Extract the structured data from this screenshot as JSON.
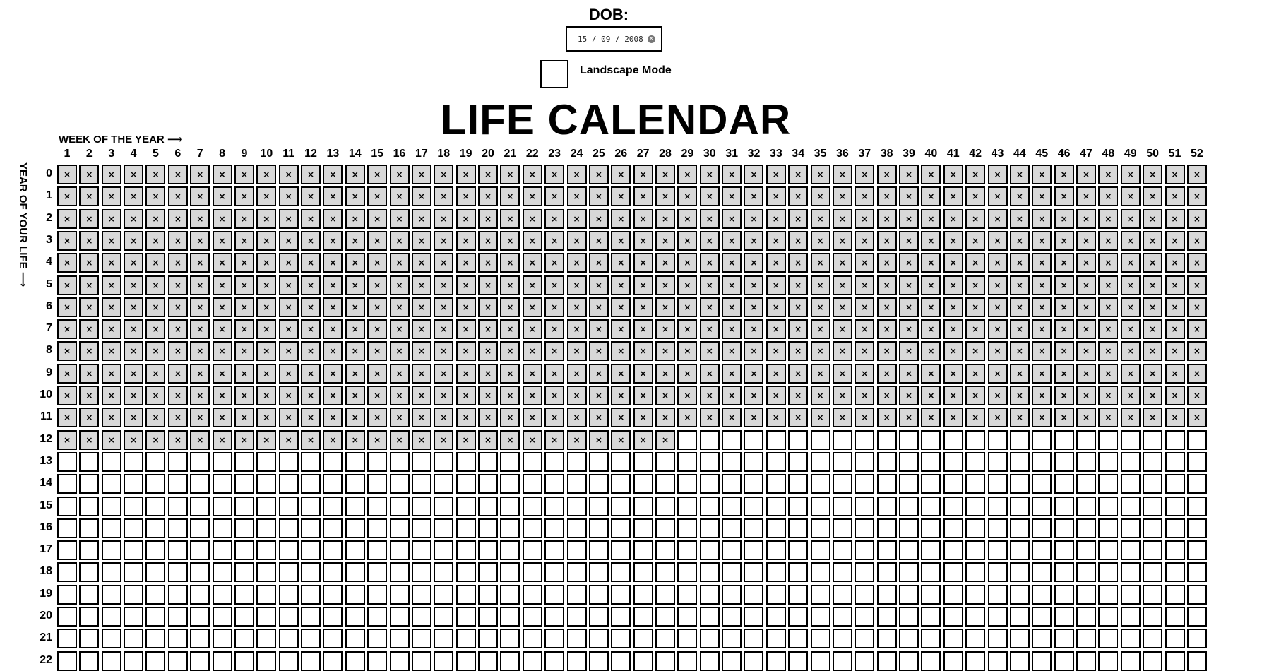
{
  "dob": {
    "label": "DOB:",
    "value": "15 / 09 / 2008",
    "clear_icon": "clear-circle-icon"
  },
  "landscape": {
    "label": "Landscape Mode",
    "checked": false
  },
  "title": "LIFE CALENDAR",
  "axes": {
    "week_label": "WEEK OF THE YEAR ⟶",
    "year_label": "YEAR OF YOUR LIFE ⟶"
  },
  "grid": {
    "weeks": [
      "1",
      "2",
      "3",
      "4",
      "5",
      "6",
      "7",
      "8",
      "9",
      "10",
      "11",
      "12",
      "13",
      "14",
      "15",
      "16",
      "17",
      "18",
      "19",
      "20",
      "21",
      "22",
      "23",
      "24",
      "25",
      "26",
      "27",
      "28",
      "29",
      "30",
      "31",
      "32",
      "33",
      "34",
      "35",
      "36",
      "37",
      "38",
      "39",
      "40",
      "41",
      "42",
      "43",
      "44",
      "45",
      "46",
      "47",
      "48",
      "49",
      "50",
      "51",
      "52"
    ],
    "years": [
      "0",
      "1",
      "2",
      "3",
      "4",
      "5",
      "6",
      "7",
      "8",
      "9",
      "10",
      "11",
      "12",
      "13",
      "14",
      "15",
      "16",
      "17",
      "18",
      "19",
      "20",
      "21",
      "22"
    ],
    "lived_weeks": 652,
    "lived_mark": "×",
    "colors": {
      "lived_fill": "#d8d8d8",
      "empty_fill": "#ffffff",
      "border": "#000000"
    }
  }
}
